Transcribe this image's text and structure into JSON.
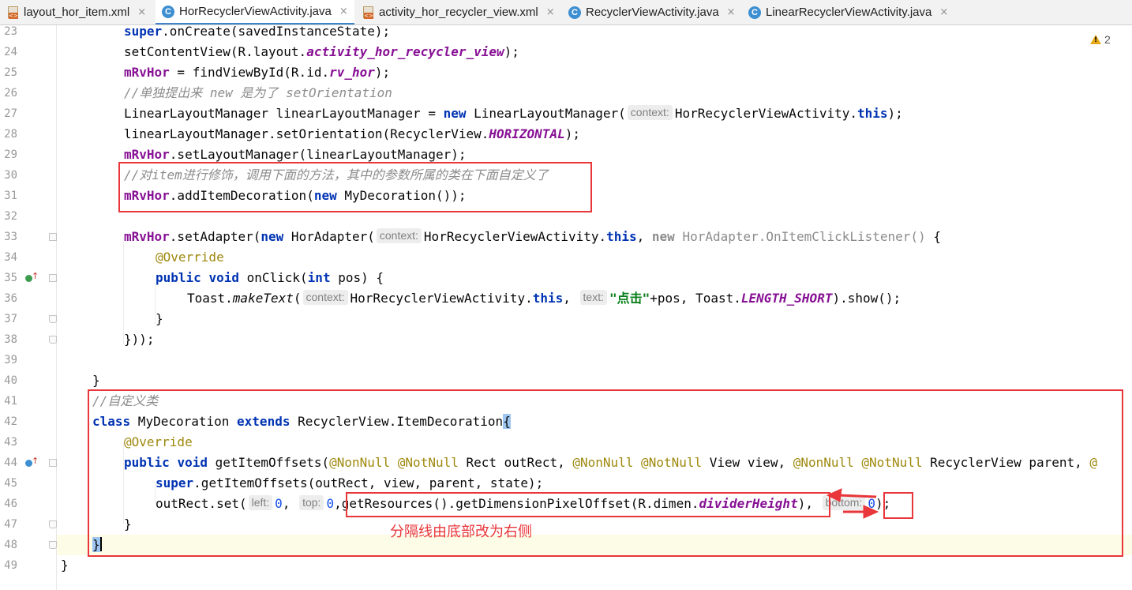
{
  "tabs": [
    {
      "label": "layout_hor_item.xml",
      "icon": "xml-file-icon",
      "active": false
    },
    {
      "label": "HorRecyclerViewActivity.java",
      "icon": "java-class-icon",
      "active": true
    },
    {
      "label": "activity_hor_recycler_view.xml",
      "icon": "xml-file-icon",
      "active": false
    },
    {
      "label": "RecyclerViewActivity.java",
      "icon": "java-class-icon",
      "active": false
    },
    {
      "label": "LinearRecyclerViewActivity.java",
      "icon": "java-class-icon",
      "active": false
    }
  ],
  "close_glyph": "×",
  "warnings": {
    "count": "2",
    "icon": "warning-icon",
    "color": "#e6a817"
  },
  "editor": {
    "line_numbers": [
      "23",
      "24",
      "25",
      "26",
      "27",
      "28",
      "29",
      "30",
      "31",
      "32",
      "33",
      "34",
      "35",
      "36",
      "37",
      "38",
      "39",
      "40",
      "41",
      "42",
      "43",
      "44",
      "45",
      "46",
      "47",
      "48",
      "49"
    ],
    "current_line": "48",
    "code": {
      "l23_a": "super",
      "l23_b": ".onCreate(savedInstanceState);",
      "l24_a": "setContentView(R.layout.",
      "l24_b": "activity_hor_recycler_view",
      "l24_c": ");",
      "l25_a": "mRvHor",
      "l25_b": " = findViewById(R.id.",
      "l25_c": "rv_hor",
      "l25_d": ");",
      "l26_a": "//单独提出来 new 是为了 setOrientation",
      "l27_a": "LinearLayoutManager linearLayoutManager = ",
      "l27_b": "new",
      "l27_c": " LinearLayoutManager(",
      "l27_hint": "context:",
      "l27_d": "HorRecyclerViewActivity.",
      "l27_e": "this",
      "l27_f": ");",
      "l28_a": "linearLayoutManager.setOrientation(RecyclerView.",
      "l28_b": "HORIZONTAL",
      "l28_c": ");",
      "l29_a": "mRvHor",
      "l29_b": ".setLayoutManager(linearLayoutManager);",
      "l30_a": "//对item进行修饰，调用下面的方法，其中的参数所属的类在下面自定义了",
      "l31_a": "mRvHor",
      "l31_b": ".addItemDecoration(",
      "l31_c": "new",
      "l31_d": " MyDecoration());",
      "l33_a": "mRvHor",
      "l33_b": ".setAdapter(",
      "l33_c": "new",
      "l33_d": " HorAdapter(",
      "l33_hint": "context:",
      "l33_e": "HorRecyclerViewActivity.",
      "l33_f": "this",
      "l33_g": ", ",
      "l33_h": "new",
      "l33_i": " HorAdapter.OnItemClickListener()",
      "l33_j": " {",
      "l34_a": "@Override",
      "l35_a": "public",
      "l35_b": " ",
      "l35_c": "void",
      "l35_d": " onClick(",
      "l35_e": "int",
      "l35_f": " pos) {",
      "l36_a": "Toast.",
      "l36_b": "makeText",
      "l36_c": "(",
      "l36_hint1": "context:",
      "l36_d": "HorRecyclerViewActivity.",
      "l36_e": "this",
      "l36_f": ", ",
      "l36_hint2": "text:",
      "l36_g": "\"点击\"",
      "l36_h": "+pos, Toast.",
      "l36_i": "LENGTH_SHORT",
      "l36_j": ").show();",
      "l37_a": "}",
      "l38_a": "}));",
      "l40_a": "}",
      "l41_a": "//自定义类",
      "l42_a": "class",
      "l42_b": " MyDecoration ",
      "l42_c": "extends",
      "l42_d": " RecyclerView.ItemDecoration",
      "l42_e": "{",
      "l43_a": "@Override",
      "l44_a": "public",
      "l44_b": " ",
      "l44_c": "void",
      "l44_d": " getItemOffsets(",
      "l44_e": "@NonNull @NotNull",
      "l44_f": " Rect outRect, ",
      "l44_g": "@NonNull @NotNull",
      "l44_h": " View view, ",
      "l44_i": "@NonNull @NotNull",
      "l44_j": " RecyclerView parent, ",
      "l44_k": "@",
      "l45_a": "super",
      "l45_b": ".getItemOffsets(outRect, view, parent, state);",
      "l46_a": "outRect.set(",
      "l46_hint1": "left:",
      "l46_b": "0",
      "l46_c": ", ",
      "l46_hint2": "top:",
      "l46_d": "0",
      "l46_e": ",",
      "l46_f": "getResources().getDimensionPixelOffset(R.dimen.",
      "l46_g": "dividerHeight",
      "l46_h": ")",
      "l46_i": ", ",
      "l46_hint3": "bottom:",
      "l46_j": "0",
      "l46_k": ");",
      "l47_a": "}",
      "l48_a": "}",
      "l49_a": "}"
    }
  },
  "annotation": {
    "note": "分隔线由底部改为右侧",
    "color": "#e8363a"
  }
}
